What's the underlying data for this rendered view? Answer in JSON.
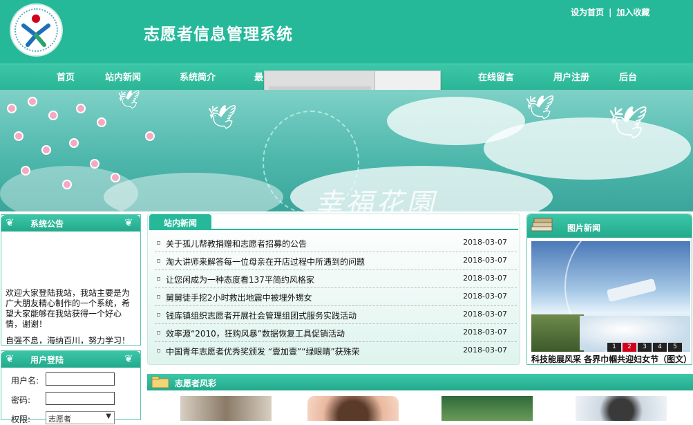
{
  "header": {
    "site_title": "志愿者信息管理系统",
    "top_links": [
      "设为首页",
      "加入收藏"
    ],
    "top_links_separator": "|"
  },
  "nav": {
    "items": [
      "首页",
      "站内新闻",
      "系统简介",
      "最",
      "在线留言",
      "用户注册",
      "后台"
    ]
  },
  "banner": {
    "text": "幸福花園"
  },
  "notice_panel": {
    "title": "系统公告",
    "text": "欢迎大家登陆我站，我站主要是为广大朋友精心制作的一个系统，希望大家能够在我站获得一个好心情，谢谢！",
    "text2": "自强不息，海纳百川，努力学习！"
  },
  "login_panel": {
    "title": "用户登陆",
    "username_label": "用户名:",
    "password_label": "密码:",
    "role_label": "权限:",
    "role_selected": "志愿者",
    "dropdown_arrow": "▼"
  },
  "news_panel": {
    "title": "站内新闻",
    "items": [
      {
        "title": "关于孤儿帮教捐赠和志愿者招募的公告",
        "date": "2018-03-07"
      },
      {
        "title": "淘大讲师来解答每一位母亲在开店过程中所遇到的问题",
        "date": "2018-03-07"
      },
      {
        "title": "让您闲成为一种态度看137平简约风格家",
        "date": "2018-03-07"
      },
      {
        "title": "舅舅徒手挖2小时救出地震中被埋外甥女",
        "date": "2018-03-07"
      },
      {
        "title": "钱库镇组织志愿者开展社会管理组团式服务实践活动",
        "date": "2018-03-07"
      },
      {
        "title": "效率源“2010，狂购风暴”数据恢复工具促销活动",
        "date": "2018-03-07"
      },
      {
        "title": "中国青年志愿者优秀奖颁发 “壹加壹”“绿眼睛”获殊荣",
        "date": "2018-03-07"
      }
    ]
  },
  "picture_panel": {
    "title": "图片新闻",
    "pager": [
      "1",
      "2",
      "3",
      "4",
      "5"
    ],
    "active_page": "2",
    "caption": "科技能展风采 各界巾帼共迎妇女节（图文）"
  },
  "volunteer_panel": {
    "title": "志愿者风彩"
  },
  "colors": {
    "primary": "#25b99a",
    "nav": "#3cc7a8",
    "pager_active": "#d0021b"
  }
}
